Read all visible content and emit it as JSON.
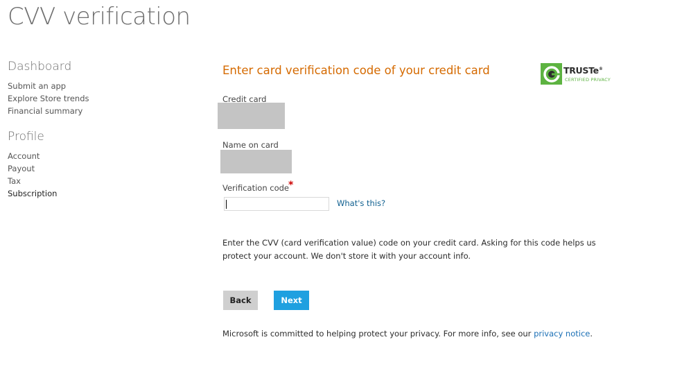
{
  "page": {
    "title": "CVV verification"
  },
  "sidebar": {
    "sections": [
      {
        "heading": "Dashboard",
        "items": [
          "Submit an app",
          "Explore Store trends",
          "Financial summary"
        ]
      },
      {
        "heading": "Profile",
        "items": [
          "Account",
          "Payout",
          "Tax",
          "Subscription"
        ]
      }
    ],
    "active_item": "Subscription"
  },
  "form": {
    "heading": "Enter card verification code of your credit card",
    "credit_card_label": "Credit card",
    "name_on_card_label": "Name on card",
    "verification_code_label": "Verification code",
    "required_marker": "*",
    "verification_code_value": "",
    "whats_this_link": "What's this?",
    "help_text": "Enter the CVV (card verification value) code on your credit card. Asking for this code helps us protect your account. We don't store it with your account info.",
    "back_button": "Back",
    "next_button": "Next",
    "privacy_prefix": "Microsoft is committed to helping protect your privacy. For more info, see our ",
    "privacy_link": "privacy notice",
    "privacy_suffix": "."
  },
  "truste": {
    "wordmark": "TRUSTe",
    "wordmark_mark": "®",
    "subtitle": "CERTIFIED PRIVACY"
  },
  "colors": {
    "heading_orange": "#d56a00",
    "next_blue": "#1fa0e0",
    "link_blue": "#1a6fb5",
    "truste_green": "#5db341",
    "redaction_gray": "#c4c4c4"
  }
}
